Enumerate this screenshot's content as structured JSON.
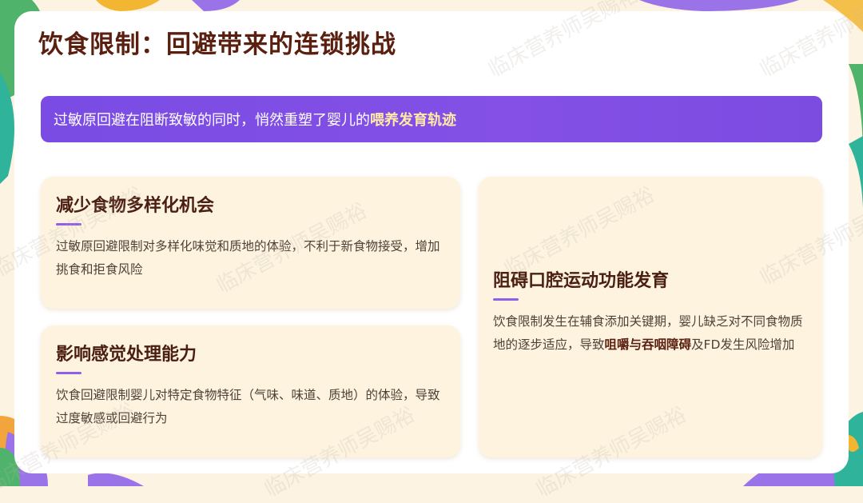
{
  "slide": {
    "title": "饮食限制：回避带来的连锁挑战",
    "banner": {
      "prefix": "过敏原回避在阻断致敏的同时，悄然重塑了婴儿的",
      "highlight": "喂养发育轨迹"
    },
    "cards": [
      {
        "heading": "减少食物多样化机会",
        "body": "过敏原回避限制对多样化味觉和质地的体验，不利于新食物接受，增加挑食和拒食风险"
      },
      {
        "heading": "影响感觉处理能力",
        "body": "饮食回避限制婴儿对特定食物特征（气味、味道、质地）的体验，导致过度敏感或回避行为"
      },
      {
        "heading": "阻碍口腔运动功能发育",
        "body_prefix": "饮食限制发生在辅食添加关键期，婴儿缺乏对不同食物质地的逐步适应，导致",
        "body_highlight": "咀嚼与吞咽障碍",
        "body_suffix": "及FD发生风险增加"
      }
    ],
    "watermark": "临床营养师吴赐裕"
  },
  "colors": {
    "title": "#5a1f0f",
    "banner": "#7a4ce3",
    "banner_highlight": "#ffe9a6",
    "card": "#fdf3df",
    "accent_bar": "#8e5fe8"
  }
}
